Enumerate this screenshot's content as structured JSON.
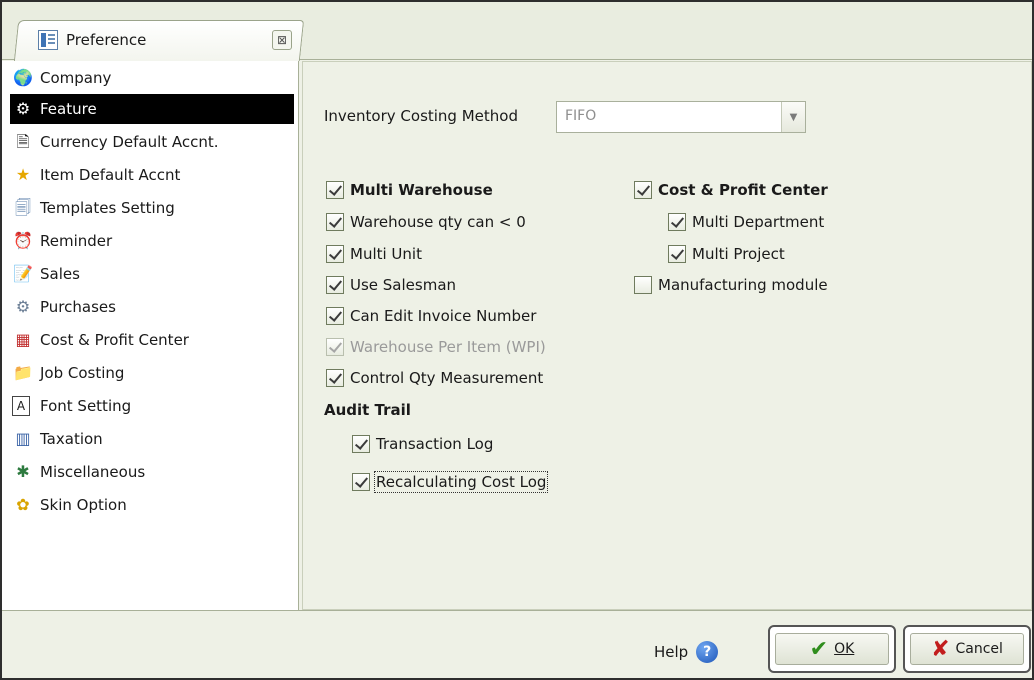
{
  "tab": {
    "label": "Preference",
    "close_glyph": "⊠"
  },
  "sidebar": {
    "items": [
      {
        "label": "Company",
        "icon": "globe-icon",
        "glyph": "🌍"
      },
      {
        "label": "Feature",
        "icon": "gear-icon",
        "glyph": "⚙",
        "selected": true
      },
      {
        "label": "Currency Default Accnt.",
        "icon": "currency-doc-icon",
        "glyph": "🗎"
      },
      {
        "label": "Item Default Accnt",
        "icon": "star-icon",
        "glyph": "★"
      },
      {
        "label": "Templates Setting",
        "icon": "template-icon",
        "glyph": "🗐"
      },
      {
        "label": "Reminder",
        "icon": "reminder-icon",
        "glyph": "⏰"
      },
      {
        "label": "Sales",
        "icon": "sales-icon",
        "glyph": "📝"
      },
      {
        "label": "Purchases",
        "icon": "purchases-icon",
        "glyph": "⚙"
      },
      {
        "label": "Cost & Profit Center",
        "icon": "grid-icon",
        "glyph": "▦"
      },
      {
        "label": "Job Costing",
        "icon": "folder-icon",
        "glyph": "📁"
      },
      {
        "label": "Font Setting",
        "icon": "font-icon",
        "glyph": "A"
      },
      {
        "label": "Taxation",
        "icon": "taxation-icon",
        "glyph": "▥"
      },
      {
        "label": "Miscellaneous",
        "icon": "misc-icon",
        "glyph": "✱"
      },
      {
        "label": "Skin Option",
        "icon": "skin-icon",
        "glyph": "✿"
      }
    ]
  },
  "main": {
    "costing_method_label": "Inventory Costing Method",
    "costing_method_value": "FIFO",
    "left_checks": [
      {
        "label": "Multi Warehouse",
        "checked": true,
        "bold": true
      },
      {
        "label": "Warehouse qty can < 0",
        "checked": true
      },
      {
        "label": "Multi Unit",
        "checked": true
      },
      {
        "label": "Use Salesman",
        "checked": true
      },
      {
        "label": "Can Edit Invoice Number",
        "checked": true
      },
      {
        "label": "Warehouse Per Item (WPI)",
        "checked": true,
        "disabled": true
      },
      {
        "label": "Control Qty Measurement",
        "checked": true
      }
    ],
    "right_checks": [
      {
        "label": "Cost & Profit Center",
        "checked": true,
        "bold": true
      },
      {
        "label": "Multi Department",
        "checked": true
      },
      {
        "label": "Multi Project",
        "checked": true
      },
      {
        "label": "Manufacturing module",
        "checked": false
      }
    ],
    "audit_title": "Audit Trail",
    "audit_checks": [
      {
        "label": "Transaction Log",
        "checked": true
      },
      {
        "label": "Recalculating Cost Log",
        "checked": true
      }
    ]
  },
  "footer": {
    "help_label": "Help",
    "help_glyph": "?",
    "ok_label": "OK",
    "ok_glyph": "✔",
    "cancel_label": "Cancel",
    "cancel_glyph": "✘"
  },
  "colors": {
    "panel_bg": "#eef1e6",
    "selected_bg": "#000000",
    "ok_green": "#2f8d1d",
    "cancel_red": "#c21d1d"
  }
}
